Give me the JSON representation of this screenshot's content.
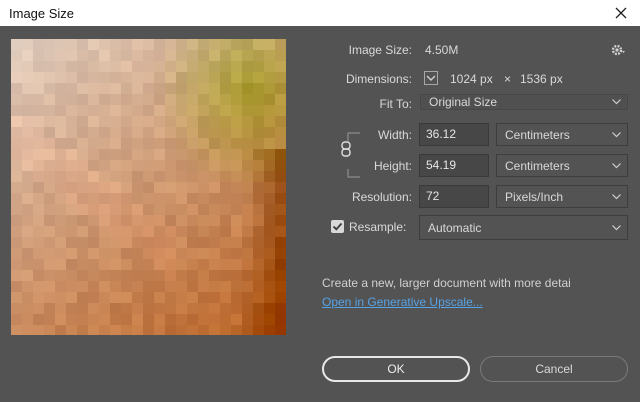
{
  "window": {
    "title": "Image Size"
  },
  "image_size": {
    "label": "Image Size:",
    "value": "4.50M"
  },
  "dimensions": {
    "label": "Dimensions:",
    "width": "1024 px",
    "times": "×",
    "height": "1536 px"
  },
  "fit_to": {
    "label": "Fit To:",
    "selected": "Original Size"
  },
  "width": {
    "label": "Width:",
    "value": "36.12",
    "unit": "Centimeters"
  },
  "height": {
    "label": "Height:",
    "value": "54.19",
    "unit": "Centimeters"
  },
  "resolution": {
    "label": "Resolution:",
    "value": "72",
    "unit": "Pixels/Inch"
  },
  "resample": {
    "label": "Resample:",
    "checked": true,
    "selected": "Automatic"
  },
  "hint": {
    "text": "Create a new, larger document with more detai",
    "link": "Open in Generative Upscale..."
  },
  "buttons": {
    "ok": "OK",
    "cancel": "Cancel"
  },
  "colors": {
    "background": "#535353",
    "link": "#56a3e6",
    "titlebar": "#ffffff"
  },
  "icons": {
    "close": "close-icon",
    "settings": "gear-icon",
    "link": "chain-link-icon",
    "dropdown": "chevron-down-icon"
  }
}
